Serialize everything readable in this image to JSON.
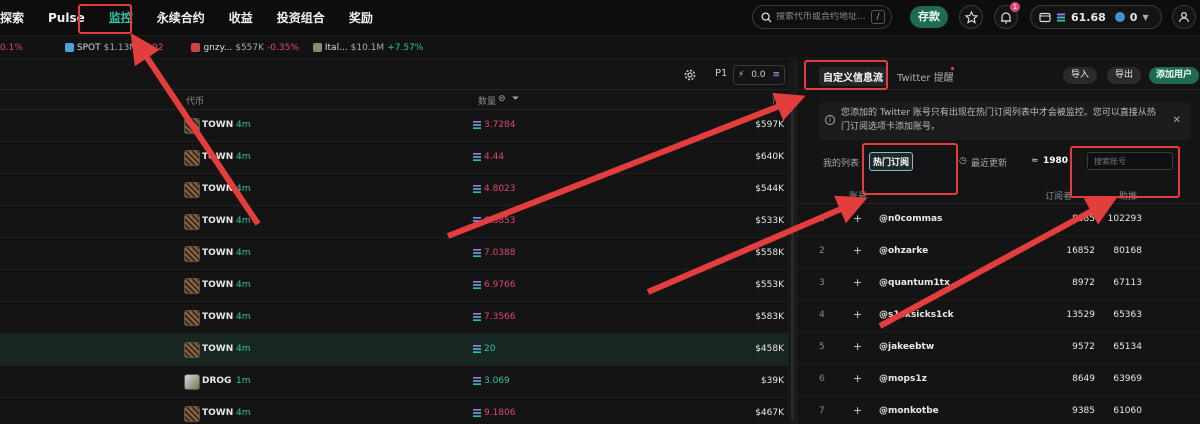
{
  "nav": {
    "items": [
      "探索",
      "Pulse",
      "监控",
      "永续合约",
      "收益",
      "投资组合",
      "奖励"
    ],
    "active_index": 2,
    "search_placeholder": "搜索代币或合约地址...",
    "search_shortcut": "/",
    "deposit_label": "存款",
    "notification_count": "1",
    "wallet_balance": "61.68",
    "wallet_points": "0"
  },
  "ticker": [
    {
      "label": "",
      "value": "",
      "change": "0.1%",
      "tone": "red"
    },
    {
      "label": "SPOT",
      "value": "$1.13M",
      "change": "-0.02",
      "tone": "red"
    },
    {
      "label": "gnzy...",
      "value": "$557K",
      "change": "-0.35%",
      "tone": "red"
    },
    {
      "label": "Ital...",
      "value": "$10.1M",
      "change": "+7.57%",
      "tone": "green"
    }
  ],
  "left_panel": {
    "preset": "P1",
    "amount": "0.0",
    "col_token": "代币",
    "col_amount": "数量",
    "col_mc": "市值",
    "rows": [
      {
        "token": "TOWN",
        "age": "4m",
        "amount": "3.7284",
        "tone": "red",
        "mc": "$597K"
      },
      {
        "token": "TOWN",
        "age": "4m",
        "amount": "4.44",
        "tone": "red",
        "mc": "$640K"
      },
      {
        "token": "TOWN",
        "age": "4m",
        "amount": "4.8023",
        "tone": "red",
        "mc": "$544K"
      },
      {
        "token": "TOWN",
        "age": "4m",
        "amount": "6.3853",
        "tone": "red",
        "mc": "$533K"
      },
      {
        "token": "TOWN",
        "age": "4m",
        "amount": "7.0388",
        "tone": "red",
        "mc": "$558K"
      },
      {
        "token": "TOWN",
        "age": "4m",
        "amount": "6.9766",
        "tone": "red",
        "mc": "$553K"
      },
      {
        "token": "TOWN",
        "age": "4m",
        "amount": "7.3566",
        "tone": "red",
        "mc": "$583K"
      },
      {
        "token": "TOWN",
        "age": "4m",
        "amount": "20",
        "tone": "green",
        "mc": "$458K"
      },
      {
        "token": "DROG",
        "age": "1m",
        "amount": "3.069",
        "tone": "green",
        "mc": "$39K"
      },
      {
        "token": "TOWN",
        "age": "4m",
        "amount": "9.1806",
        "tone": "red",
        "mc": "$467K"
      }
    ]
  },
  "right_panel": {
    "tab_custom": "自定义信息流",
    "tab_twitter": "Twitter 提醒",
    "import_label": "导入",
    "export_label": "导出",
    "add_user_label": "添加用户",
    "notice": "您添加的 Twitter 账号只有出现在热门订阅列表中才会被监控。您可以直接从热门订阅选项卡添加账号。",
    "sub_my_list": "我的列表",
    "sub_hot": "热门订阅",
    "sub_recent": "最近更新",
    "count": "1980",
    "search_placeholder": "搜索账号",
    "col_account": "账号",
    "col_subs": "订阅者",
    "col_boost": "助推",
    "rows": [
      {
        "rank": "1",
        "handle": "@n0commas",
        "subs": "8585",
        "boost": "102293"
      },
      {
        "rank": "2",
        "handle": "@ohzarke",
        "subs": "16852",
        "boost": "80168"
      },
      {
        "rank": "3",
        "handle": "@quantum1tx",
        "subs": "8972",
        "boost": "67113"
      },
      {
        "rank": "4",
        "handle": "@s1cksicks1ck",
        "subs": "13529",
        "boost": "65363"
      },
      {
        "rank": "5",
        "handle": "@jakeebtw",
        "subs": "9572",
        "boost": "65134"
      },
      {
        "rank": "6",
        "handle": "@mops1z",
        "subs": "8649",
        "boost": "63969"
      },
      {
        "rank": "7",
        "handle": "@monkotbe",
        "subs": "9385",
        "boost": "61060"
      }
    ]
  },
  "colors": {
    "accent": "#2fc5a4",
    "negative": "#e0457b",
    "annotation": "#e33d3d"
  }
}
